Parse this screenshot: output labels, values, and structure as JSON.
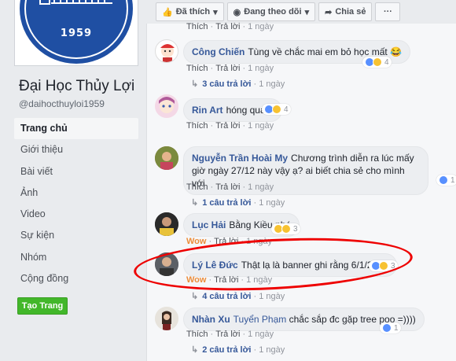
{
  "page": {
    "name": "Đại Học Thủy Lợi",
    "handle": "@daihocthuyloi1959",
    "logo_year": "1959"
  },
  "nav": [
    {
      "label": "Trang chủ"
    },
    {
      "label": "Giới thiệu"
    },
    {
      "label": "Bài viết"
    },
    {
      "label": "Ảnh"
    },
    {
      "label": "Video"
    },
    {
      "label": "Sự kiện"
    },
    {
      "label": "Nhóm"
    },
    {
      "label": "Cộng đồng"
    }
  ],
  "create_page_label": "Tạo Trang",
  "toolbar": {
    "like_label": "Đã thích",
    "follow_label": "Đang theo dõi",
    "share_label": "Chia sẻ",
    "more_label": "···"
  },
  "actions": {
    "like": "Thích",
    "wow": "Wow",
    "reply": "Trả lời",
    "dot": "·",
    "top_time": "1 ngày"
  },
  "comments": [
    {
      "author": "Công Chiến",
      "text": "Tùng về chắc mai em bỏ học mất 😂",
      "reactions": "4",
      "reaction_label": "Thích",
      "time": "1 ngày",
      "replies": "3 câu trả lời",
      "replies_time": "1 ngày"
    },
    {
      "author": "Rin Art",
      "text": "hóng quá a",
      "reactions": "4",
      "reaction_label": "Thích",
      "time": "1 ngày",
      "replies": "",
      "replies_time": ""
    },
    {
      "author": "Nguyễn Trần Hoài My",
      "text": "Chương trình diễn ra lúc mấy giờ ngày 27/12 này vậy ạ? ai biết chia sẻ cho mình với",
      "reactions": "1",
      "reaction_label": "Thích",
      "time": "1 ngày",
      "replies": "1 câu trả lời",
      "replies_time": "1 ngày"
    },
    {
      "author": "Lục Hải",
      "text": "Bằng Kiều nhé",
      "reactions": "3",
      "reaction_label": "Wow",
      "time": "1 ngày",
      "replies": "",
      "replies_time": ""
    },
    {
      "author": "Lý Lê Đức",
      "text": "Thật lạ là banner ghi rằng 6/1/2017",
      "reactions": "3",
      "reaction_label": "Wow",
      "time": "1 ngày",
      "replies": "4 câu trả lời",
      "replies_time": "1 ngày"
    },
    {
      "author": "Nhàn Xu",
      "mention": "Tuyển Phạm",
      "text": "chắc sắp đc gặp tree poo =))))",
      "reactions": "1",
      "reaction_label": "Thích",
      "time": "1 ngày",
      "replies": "2 câu trả lời",
      "replies_time": "1 ngày"
    }
  ],
  "colors": {
    "link": "#365899",
    "accent": "#42b72a",
    "highlight": "#e00000"
  }
}
